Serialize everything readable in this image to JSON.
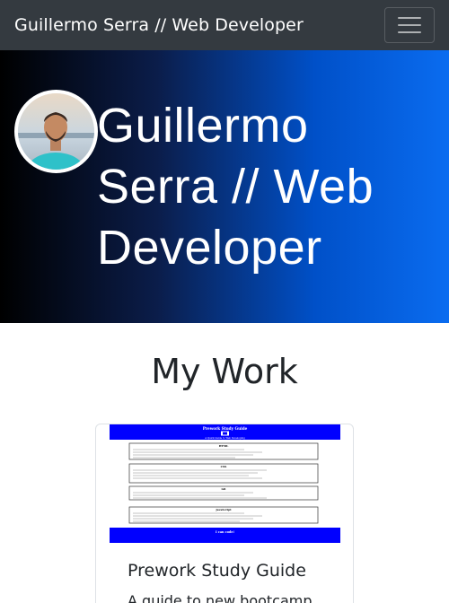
{
  "navbar": {
    "brand": "Guillermo Serra // Web Developer",
    "toggler_icon": "hamburger-menu-icon"
  },
  "hero": {
    "title": "Guillermo Serra // Web Developer",
    "avatar": "profile-photo"
  },
  "work": {
    "heading": "My Work",
    "projects": [
      {
        "title": "Prework Study Guide",
        "description": "A guide to new bootcamp",
        "thumbnail": {
          "header": "Prework Study Guide",
          "subheader": "A Quick Guide to Web Developing",
          "sections": [
            "HTML",
            "CSS",
            "Git",
            "JavaScript"
          ],
          "footer": "I can code!",
          "accent_color": "#0000ff"
        }
      }
    ]
  },
  "colors": {
    "navbar_bg": "#343a40",
    "hero_gradient_start": "#000000",
    "hero_gradient_end": "#0a6cf0"
  }
}
